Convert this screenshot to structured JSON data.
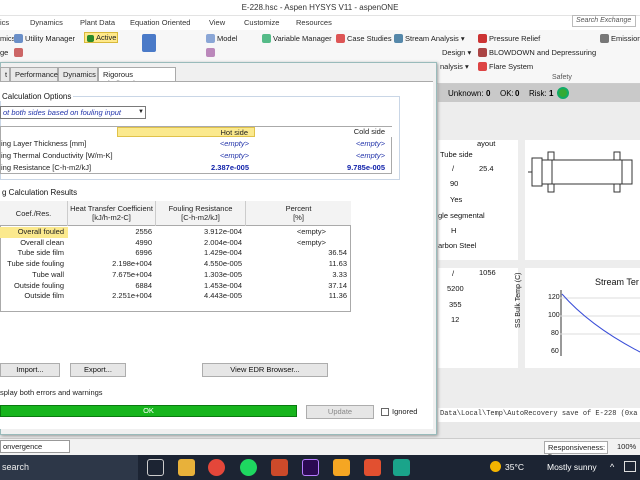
{
  "window": {
    "title": "E-228.hsc - Aspen HYSYS V11 - aspenONE"
  },
  "menu_tabs": [
    "ics",
    "Dynamics",
    "Plant Data",
    "Equation Oriented",
    "View",
    "Customize",
    "Resources"
  ],
  "search": {
    "placeholder": "Search Exchange"
  },
  "ribbon": {
    "col1": [
      "mics",
      "ge",
      "s"
    ],
    "utility_manager": "Utility Manager",
    "active": "Active",
    "model": "Model",
    "variable_manager": "Variable Manager",
    "case_studies": "Case Studies",
    "stream_analysis": "Stream Analysis",
    "design": "Design",
    "analysis": "nalysis",
    "pressure_relief": "Pressure Relief",
    "blowdown": "BLOWDOWN and Depressuring",
    "flare_system": "Flare System",
    "emission": "Emission",
    "safety": "Safety"
  },
  "status_counts": {
    "unknown_label": "Unknown:",
    "unknown": "0",
    "ok_label": "OK:",
    "ok": "0",
    "risk_label": "Risk:",
    "risk": "1"
  },
  "background": {
    "layout_label": "ayout",
    "tube_side": "Tube side",
    "v1": "/",
    "v2": "25.4",
    "v3": "90",
    "v4": "Yes",
    "segmental": "gle segmental",
    "v5": "H",
    "material": "arbon Steel",
    "v6": "/",
    "v7": "1056",
    "v8": "5200",
    "v9": "355",
    "v10": "12",
    "chart_title": "Stream Ter",
    "chart_ylabel": "SS Bulk Temp (C)",
    "y_ticks": [
      "120",
      "100",
      "80",
      "60"
    ]
  },
  "dialog": {
    "tabs": [
      "t",
      "Performance",
      "Dynamics",
      "Rigorous Shell&Tube"
    ],
    "calc_options_label": "Calculation Options",
    "calc_select": "ot both sides based on fouling input",
    "grid_headers": {
      "hot": "Hot side",
      "cold": "Cold side"
    },
    "grid_rows": [
      {
        "label": "ing Layer Thickness [mm]",
        "hot": "<empty>",
        "cold": "<empty>",
        "style": "empty"
      },
      {
        "label": "ing Thermal Conductivity [W/m-K]",
        "hot": "<empty>",
        "cold": "<empty>",
        "style": "empty"
      },
      {
        "label": "ing Resistance [C-h-m2/kJ]",
        "hot": "2.387e-005",
        "cold": "9.785e-005",
        "style": "bold"
      }
    ],
    "results_label": "g Calculation Results",
    "results_headers": [
      "Coef./Res.",
      "Heat Transfer Coefficient\n[kJ/h-m2-C]",
      "Fouling Resistance\n[C-h-m2/kJ]",
      "Percent\n[%]"
    ],
    "results_rows": [
      [
        "Overall fouled",
        "2556",
        "3.912e-004",
        "<empty>"
      ],
      [
        "Overall clean",
        "4990",
        "2.004e-004",
        "<empty>"
      ],
      [
        "Tube side film",
        "6996",
        "1.429e-004",
        "36.54"
      ],
      [
        "Tube side fouling",
        "2.198e+004",
        "4.550e-005",
        "11.63"
      ],
      [
        "Tube wall",
        "7.675e+004",
        "1.303e-005",
        "3.33"
      ],
      [
        "Outside fouling",
        "6884",
        "1.453e-004",
        "37.14"
      ],
      [
        "Outside film",
        "2.251e+004",
        "4.443e-005",
        "11.36"
      ]
    ],
    "import_btn": "Import...",
    "export_btn": "Export...",
    "edr_btn": "View EDR Browser...",
    "check_text": "splay both errors and warnings",
    "ok_status": "OK",
    "update_btn": "Update",
    "ignored": "Ignored"
  },
  "path_text": "Data\\Local\\Temp\\AutoRecovery save of E-228 (0xa",
  "responsiveness": "Responsiveness: 5",
  "zoom": "100%",
  "convergence": "onvergence",
  "taskbar": {
    "search": "search",
    "temp": "35°C",
    "weather": "Mostly sunny"
  }
}
